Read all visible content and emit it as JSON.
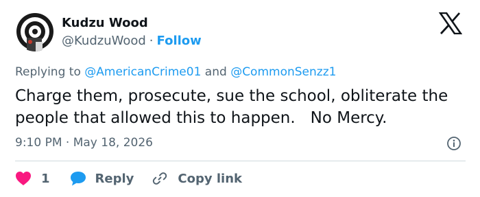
{
  "author": {
    "name": "Kudzu Wood",
    "handle": "@KudzuWood",
    "separator": "·",
    "follow_label": "Follow",
    "avatar_icon": "target-avatar-icon"
  },
  "brand": {
    "logo_icon": "x-logo-icon"
  },
  "reply_context": {
    "prefix": "Replying to",
    "mention_1": "@AmericanCrime01",
    "conjunction": "and",
    "mention_2": "@CommonSenzz1"
  },
  "tweet": {
    "text": "Charge them, prosecute, sue the school, obliterate the people that allowed this to happen.   No Mercy.",
    "time": "9:10 PM",
    "separator": "·",
    "date": "May 18, 2026"
  },
  "actions": {
    "like_count": "1",
    "reply_label": "Reply",
    "copy_link_label": "Copy link"
  },
  "colors": {
    "accent": "#1d9bf0",
    "like": "#f91880",
    "text": "#0f1419",
    "muted": "#536471",
    "divider": "#cfd9de"
  }
}
